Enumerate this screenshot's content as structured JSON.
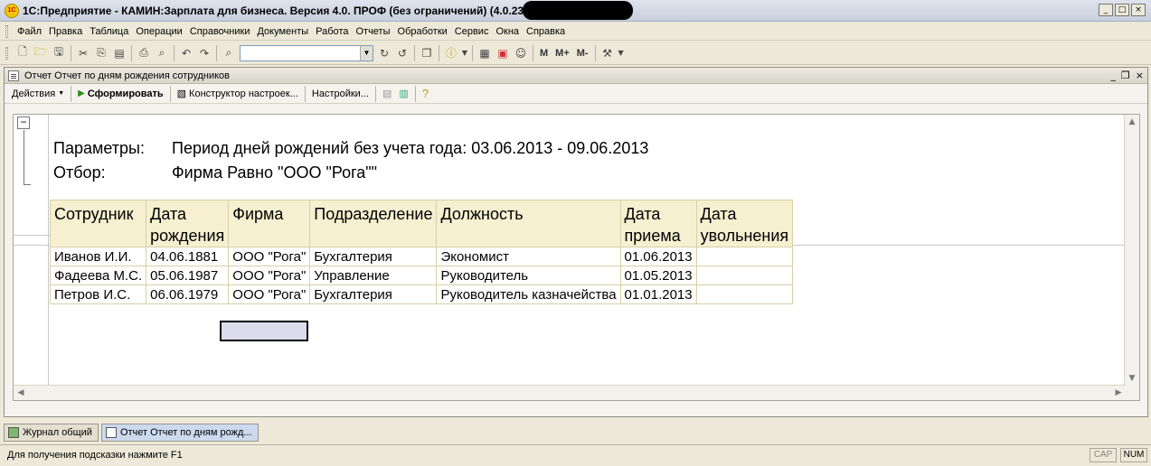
{
  "app": {
    "title": "1С:Предприятие - КАМИН:Зарплата для бизнеса. Версия 4.0. ПРОФ (без ограничений) (4.0.23.3)",
    "logo_text": "1С",
    "window_controls": [
      "_",
      "□",
      "×"
    ]
  },
  "menu": [
    "Файл",
    "Правка",
    "Таблица",
    "Операции",
    "Справочники",
    "Документы",
    "Работа",
    "Отчеты",
    "Обработки",
    "Сервис",
    "Окна",
    "Справка"
  ],
  "toolbar": {
    "search_value": "",
    "m_buttons": [
      "M",
      "M+",
      "M-"
    ]
  },
  "document": {
    "title": "Отчет  Отчет по дням рождения сотрудников",
    "toolbar": {
      "actions": "Действия",
      "generate": "Сформировать",
      "designer": "Конструктор настроек...",
      "settings": "Настройки..."
    },
    "params_label": "Параметры:",
    "params_value": "Период дней рождений без учета года: 03.06.2013 - 09.06.2013",
    "filter_label": "Отбор:",
    "filter_value": "Фирма Равно \"ООО \"Рога\"\"",
    "table": {
      "headers": [
        "Сотрудник",
        "Дата рождения",
        "Фирма",
        "Подразделение",
        "Должность",
        "Дата приема",
        "Дата увольнения"
      ],
      "rows": [
        [
          "Иванов И.И.",
          "04.06.1881",
          "ООО \"Рога\"",
          "Бухгалтерия",
          "Экономист",
          "01.06.2013",
          ""
        ],
        [
          "Фадеева М.С.",
          "05.06.1987",
          "ООО \"Рога\"",
          "Управление",
          "Руководитель",
          "01.05.2013",
          ""
        ],
        [
          "Петров И.С.",
          "06.06.1979",
          "ООО \"Рога\"",
          "Бухгалтерия",
          "Руководитель казначейства",
          "01.01.2013",
          ""
        ]
      ]
    }
  },
  "tabs": [
    "Журнал общий",
    "Отчет  Отчет по дням рожд..."
  ],
  "status": {
    "hint": "Для получения подсказки нажмите F1",
    "cap": "CAP",
    "num": "NUM"
  }
}
